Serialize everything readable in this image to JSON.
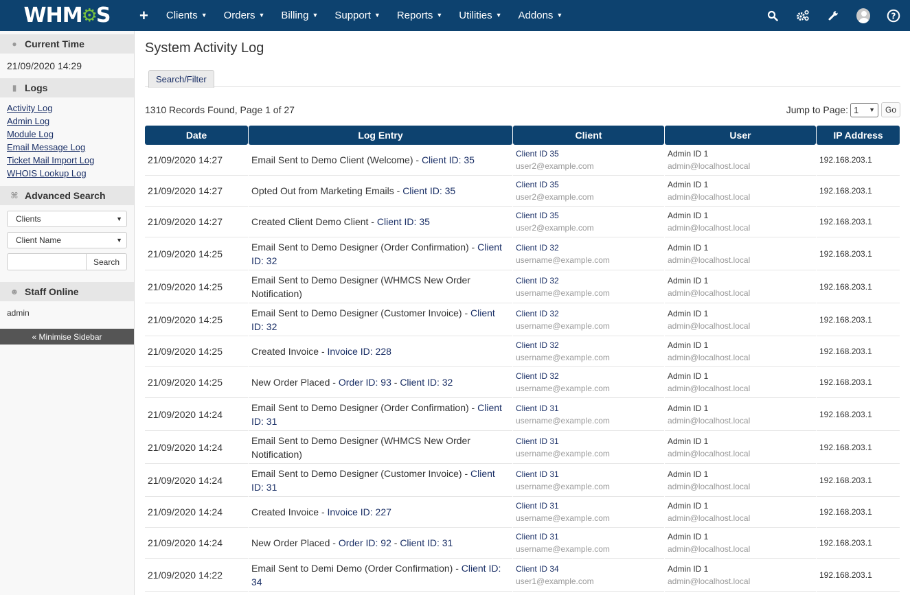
{
  "topnav": {
    "logo": {
      "prefix": "WHM",
      "suffix": "S"
    },
    "add_icon": "plus-icon",
    "menu": [
      "Clients",
      "Orders",
      "Billing",
      "Support",
      "Reports",
      "Utilities",
      "Addons"
    ],
    "right_icons": [
      "search-icon",
      "gears-icon",
      "wrench-icon",
      "user-avatar",
      "help-icon"
    ],
    "brand_color": "#0d426f",
    "accent_color": "#7cc63b"
  },
  "sidebar": {
    "current_time": {
      "title": "Current Time",
      "value": "21/09/2020 14:29"
    },
    "logs": {
      "title": "Logs",
      "links": [
        "Activity Log",
        "Admin Log",
        "Module Log",
        "Email Message Log",
        "Ticket Mail Import Log",
        "WHOIS Lookup Log"
      ]
    },
    "advanced_search": {
      "title": "Advanced Search",
      "type_select": "Clients",
      "field_select": "Client Name",
      "query_value": "",
      "search_button": "Search"
    },
    "staff_online": {
      "title": "Staff Online",
      "users": [
        "admin"
      ]
    },
    "minimise_label": "« Minimise Sidebar"
  },
  "main": {
    "title": "System Activity Log",
    "tab": "Search/Filter",
    "records_text": "1310 Records Found, Page 1 of 27",
    "jump_label": "Jump to Page:",
    "jump_value": "1",
    "go_label": "Go",
    "columns": [
      "Date",
      "Log Entry",
      "Client",
      "User",
      "IP Address"
    ],
    "rows": [
      {
        "date": "21/09/2020 14:27",
        "entry": "Email Sent to Demo Client (Welcome) - ",
        "links": [
          "Client ID: 35"
        ],
        "client_id": "Client ID 35",
        "client_email": "user2@example.com",
        "user_id": "Admin ID 1",
        "user_email": "admin@localhost.local",
        "ip": "192.168.203.1"
      },
      {
        "date": "21/09/2020 14:27",
        "entry": "Opted Out from Marketing Emails - ",
        "links": [
          "Client ID: 35"
        ],
        "client_id": "Client ID 35",
        "client_email": "user2@example.com",
        "user_id": "Admin ID 1",
        "user_email": "admin@localhost.local",
        "ip": "192.168.203.1"
      },
      {
        "date": "21/09/2020 14:27",
        "entry": "Created Client Demo Client - ",
        "links": [
          "Client ID: 35"
        ],
        "client_id": "Client ID 35",
        "client_email": "user2@example.com",
        "user_id": "Admin ID 1",
        "user_email": "admin@localhost.local",
        "ip": "192.168.203.1"
      },
      {
        "date": "21/09/2020 14:25",
        "entry": "Email Sent to Demo Designer (Order Confirmation) - ",
        "links": [
          "Client ID: 32"
        ],
        "client_id": "Client ID 32",
        "client_email": "username@example.com",
        "user_id": "Admin ID 1",
        "user_email": "admin@localhost.local",
        "ip": "192.168.203.1"
      },
      {
        "date": "21/09/2020 14:25",
        "entry": "Email Sent to Demo Designer (WHMCS New Order Notification)",
        "links": [],
        "client_id": "Client ID 32",
        "client_email": "username@example.com",
        "user_id": "Admin ID 1",
        "user_email": "admin@localhost.local",
        "ip": "192.168.203.1"
      },
      {
        "date": "21/09/2020 14:25",
        "entry": "Email Sent to Demo Designer (Customer Invoice) - ",
        "links": [
          "Client ID: 32"
        ],
        "client_id": "Client ID 32",
        "client_email": "username@example.com",
        "user_id": "Admin ID 1",
        "user_email": "admin@localhost.local",
        "ip": "192.168.203.1"
      },
      {
        "date": "21/09/2020 14:25",
        "entry": "Created Invoice - ",
        "links": [
          "Invoice ID: 228"
        ],
        "client_id": "Client ID 32",
        "client_email": "username@example.com",
        "user_id": "Admin ID 1",
        "user_email": "admin@localhost.local",
        "ip": "192.168.203.1"
      },
      {
        "date": "21/09/2020 14:25",
        "entry": "New Order Placed - ",
        "links": [
          "Order ID: 93",
          "Client ID: 32"
        ],
        "client_id": "Client ID 32",
        "client_email": "username@example.com",
        "user_id": "Admin ID 1",
        "user_email": "admin@localhost.local",
        "ip": "192.168.203.1"
      },
      {
        "date": "21/09/2020 14:24",
        "entry": "Email Sent to Demo Designer (Order Confirmation) - ",
        "links": [
          "Client ID: 31"
        ],
        "client_id": "Client ID 31",
        "client_email": "username@example.com",
        "user_id": "Admin ID 1",
        "user_email": "admin@localhost.local",
        "ip": "192.168.203.1"
      },
      {
        "date": "21/09/2020 14:24",
        "entry": "Email Sent to Demo Designer (WHMCS New Order Notification)",
        "links": [],
        "client_id": "Client ID 31",
        "client_email": "username@example.com",
        "user_id": "Admin ID 1",
        "user_email": "admin@localhost.local",
        "ip": "192.168.203.1"
      },
      {
        "date": "21/09/2020 14:24",
        "entry": "Email Sent to Demo Designer (Customer Invoice) - ",
        "links": [
          "Client ID: 31"
        ],
        "client_id": "Client ID 31",
        "client_email": "username@example.com",
        "user_id": "Admin ID 1",
        "user_email": "admin@localhost.local",
        "ip": "192.168.203.1"
      },
      {
        "date": "21/09/2020 14:24",
        "entry": "Created Invoice - ",
        "links": [
          "Invoice ID: 227"
        ],
        "client_id": "Client ID 31",
        "client_email": "username@example.com",
        "user_id": "Admin ID 1",
        "user_email": "admin@localhost.local",
        "ip": "192.168.203.1"
      },
      {
        "date": "21/09/2020 14:24",
        "entry": "New Order Placed - ",
        "links": [
          "Order ID: 92",
          "Client ID: 31"
        ],
        "client_id": "Client ID 31",
        "client_email": "username@example.com",
        "user_id": "Admin ID 1",
        "user_email": "admin@localhost.local",
        "ip": "192.168.203.1"
      },
      {
        "date": "21/09/2020 14:22",
        "entry": "Email Sent to Demi Demo (Order Confirmation) - ",
        "links": [
          "Client ID: 34"
        ],
        "client_id": "Client ID 34",
        "client_email": "user1@example.com",
        "user_id": "Admin ID 1",
        "user_email": "admin@localhost.local",
        "ip": "192.168.203.1"
      }
    ]
  }
}
